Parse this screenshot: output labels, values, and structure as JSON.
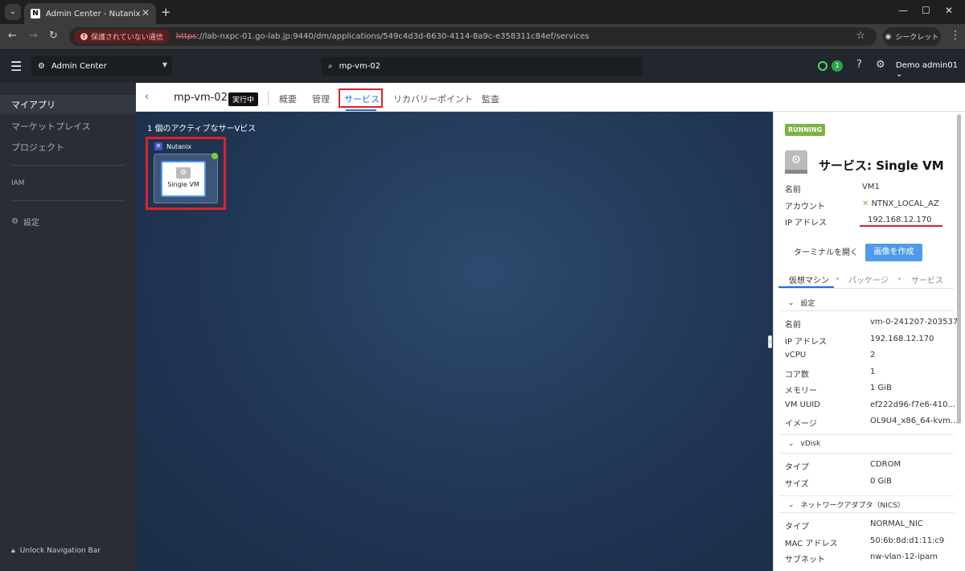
{
  "browser": {
    "tab_title": "Admin Center - Nutanix",
    "security_label": "保護されていない通信",
    "url_scheme": "https",
    "url_rest": "://lab-nxpc-01.go-lab.jp:9440/dm/applications/549c4d3d-6630-4114-8a9c-e358311c84ef/services",
    "incognito_label": "シークレット"
  },
  "header": {
    "app_switch": "Admin Center",
    "search_value": "mp-vm-02",
    "alert_count": "1",
    "user": "Demo admin01"
  },
  "sidebar": {
    "items": [
      {
        "label": "マイアプリ"
      },
      {
        "label": "マーケットプレイス"
      },
      {
        "label": "プロジェクト"
      },
      {
        "label": "IAM"
      },
      {
        "label": "設定"
      }
    ],
    "unlock": "Unlock Navigation Bar"
  },
  "subheader": {
    "app_name": "mp-vm-02",
    "state": "実行中",
    "tabs": [
      {
        "label": "概要"
      },
      {
        "label": "管理"
      },
      {
        "label": "サービス"
      },
      {
        "label": "リカバリーポイント"
      },
      {
        "label": "監査"
      }
    ]
  },
  "canvas": {
    "title": "1 個のアクティブなサーVビス",
    "provider": "Nutanix",
    "service_name": "Single VM"
  },
  "panel": {
    "status": "RUNNING",
    "title": "サービス: Single VM",
    "info": [
      {
        "k": "名前",
        "v": "VM1"
      },
      {
        "k": "アカウント",
        "v": "NTNX_LOCAL_AZ"
      },
      {
        "k": "IP アドレス",
        "v": "192.168.12.170"
      }
    ],
    "btn_terminal": "ターミナルを開く",
    "btn_image": "画像を作成",
    "tabs": [
      {
        "label": "仮想マシン"
      },
      {
        "label": "パッケージ"
      },
      {
        "label": "サービス"
      }
    ],
    "section_settings": "設定",
    "settings": [
      {
        "k": "名前",
        "v": "vm-0-241207-203537"
      },
      {
        "k": "IP アドレス",
        "v": "192.168.12.170"
      },
      {
        "k": "vCPU",
        "v": "2"
      },
      {
        "k": "コア数",
        "v": "1"
      },
      {
        "k": "メモリー",
        "v": "1 GiB"
      },
      {
        "k": "VM UUID",
        "v": "ef222d96-f7e6-4102..."
      },
      {
        "k": "イメージ",
        "v": "OL9U4_x86_64-kvm..."
      }
    ],
    "section_vdisk": "vDisk",
    "vdisk": [
      {
        "k": "タイプ",
        "v": "CDROM"
      },
      {
        "k": "サイズ",
        "v": "0 GiB"
      }
    ],
    "section_nic": "ネットワークアダプタ（NICS）",
    "nic": [
      {
        "k": "タイプ",
        "v": "NORMAL_NIC"
      },
      {
        "k": "MAC アドレス",
        "v": "50:6b:8d:d1:11:c9"
      },
      {
        "k": "サブネット",
        "v": "nw-vlan-12-ipam"
      }
    ]
  }
}
